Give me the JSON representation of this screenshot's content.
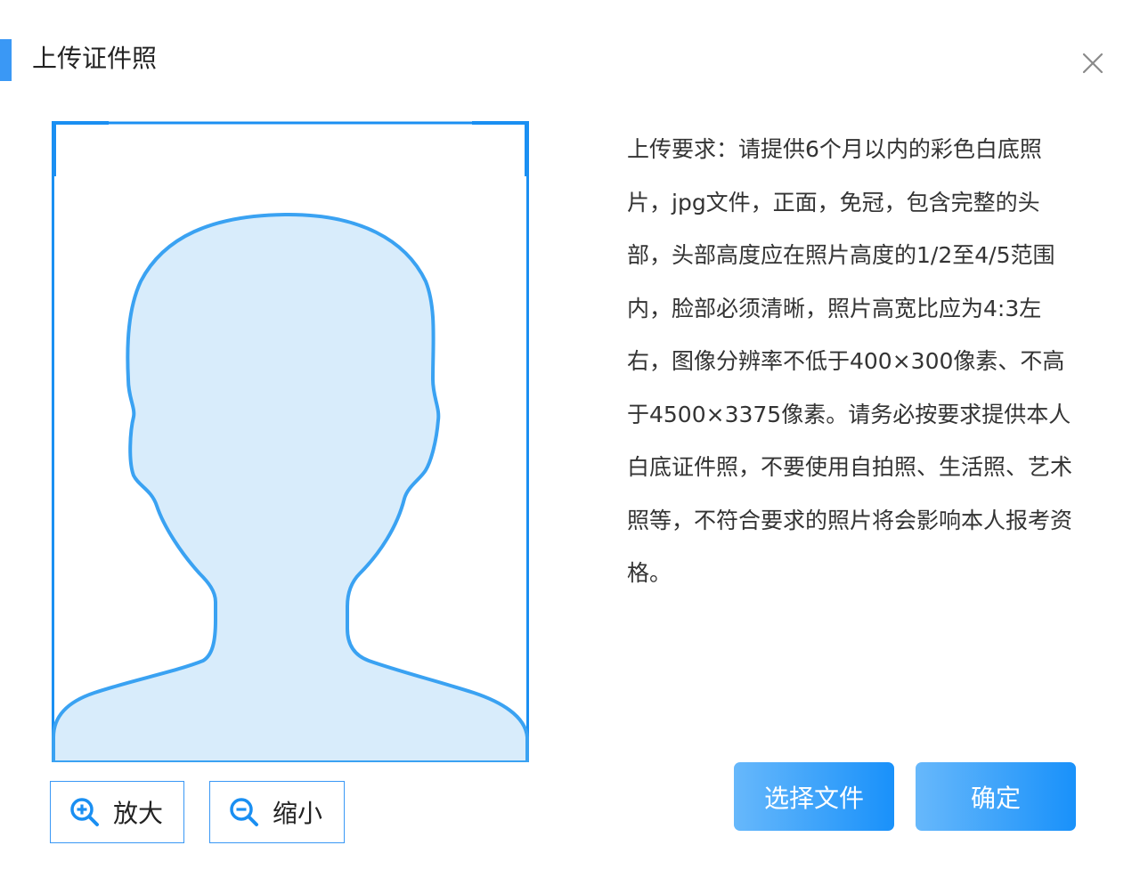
{
  "dialog": {
    "title": "上传证件照",
    "close_icon": "close-icon"
  },
  "photo": {
    "placeholder_icon": "person-silhouette-icon",
    "outline_color": "#3aa2f2",
    "fill_color": "#d8ecfb",
    "frame_color": "#1a8ff2"
  },
  "zoom": {
    "zoom_in_label": "放大",
    "zoom_out_label": "缩小",
    "zoom_in_icon": "zoom-in-icon",
    "zoom_out_icon": "zoom-out-icon"
  },
  "requirements": {
    "text": "上传要求：请提供6个月以内的彩色白底照片，jpg文件，正面，免冠，包含完整的头部，头部高度应在照片高度的1/2至4/5范围内，脸部必须清晰，照片高宽比应为4:3左右，图像分辨率不低于400×300像素、不高于4500×3375像素。请务必按要求提供本人白底证件照，不要使用自拍照、生活照、艺术照等，不符合要求的照片将会影响本人报考资格。"
  },
  "actions": {
    "select_file_label": "选择文件",
    "confirm_label": "确定"
  },
  "colors": {
    "accent": "#3a98f5",
    "button_gradient_start": "#67b8fb",
    "button_gradient_end": "#1991fa"
  }
}
